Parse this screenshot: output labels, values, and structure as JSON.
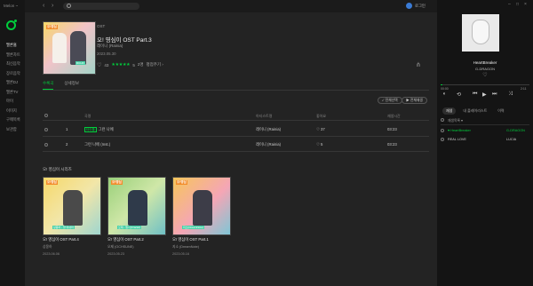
{
  "app": {
    "brand": "Melon ~"
  },
  "sidebar": {
    "items": [
      {
        "label": "멜론홈"
      },
      {
        "label": "멜론차트"
      },
      {
        "label": "최신음악"
      },
      {
        "label": "장르음악"
      },
      {
        "label": "멜론DJ"
      },
      {
        "label": "멜론TV"
      },
      {
        "label": "마이"
      },
      {
        "label": "이미지"
      },
      {
        "label": "구매목록"
      },
      {
        "label": "보관함"
      }
    ]
  },
  "topbar": {
    "search_placeholder": "",
    "login_label": "로그인"
  },
  "album": {
    "type": "OST",
    "title": "오! 영심이 OST Part.3",
    "artist": "레이니 (Rainia)",
    "date": "2023.05.30",
    "likes": "43",
    "rating": "5",
    "rating_count": "2명",
    "rate_label": "평점주기 ›",
    "cover_badge": "오!영심",
    "cover_tag": "RCHO"
  },
  "tabs": [
    {
      "label": "수록곡"
    },
    {
      "label": "상세정보"
    }
  ],
  "actions": {
    "select_all": "✓ 전체선택",
    "play_all": "▶ 전체재생"
  },
  "table": {
    "headers": {
      "title": "곡명",
      "artist": "아티스트명",
      "like": "좋아요",
      "length": "재생시간"
    },
    "rows": [
      {
        "no": "1",
        "badge": "타이틀",
        "title": "그런 나에",
        "artist": "레이니 (Rainia)",
        "likes": "♡ 37",
        "length": "03:23"
      },
      {
        "no": "2",
        "badge": "",
        "title": "그런 나에 (Inst.)",
        "artist": "레이니 (Rainia)",
        "likes": "♡ 5",
        "length": "03:23"
      }
    ]
  },
  "series": {
    "title": "오! 영심이 시리즈",
    "cards": [
      {
        "title": "오! 영심이 OST Part.4",
        "artist": "상몽하",
        "date": "2023.06.06",
        "badge": "오!영심",
        "cap": "상몽하 - 잘 지내라"
      },
      {
        "title": "오! 영심이 OST Part.2",
        "artist": "오제 (OCHSUNE)",
        "date": "2023.05.23",
        "badge": "오!영심",
        "cap": "오제 - 행시(Crackd)"
      },
      {
        "title": "오! 영심이 OST Part.1",
        "artist": "지소 (DreamNote)",
        "date": "2023.05.16",
        "badge": "오!영심",
        "cap": "지소(DreamNote)"
      }
    ]
  },
  "player": {
    "title": "HeartBreaker",
    "artist": "G-DRAGON",
    "progress": 0.02,
    "elapsed": "00:00",
    "total": "2:11",
    "tabs": [
      {
        "label": "재생"
      },
      {
        "label": "내 플레이리스트"
      },
      {
        "label": "이력"
      }
    ],
    "list_header": "재생목록 ▾",
    "tracks": [
      {
        "title": "♥ HeartBreaker",
        "artist": "G-DRAGON"
      },
      {
        "title": "REAL LOVE",
        "artist": "LUCIA"
      }
    ]
  },
  "colors": {
    "accent": "#00cd3c",
    "background": "#232323",
    "sidebar": "#161616"
  }
}
